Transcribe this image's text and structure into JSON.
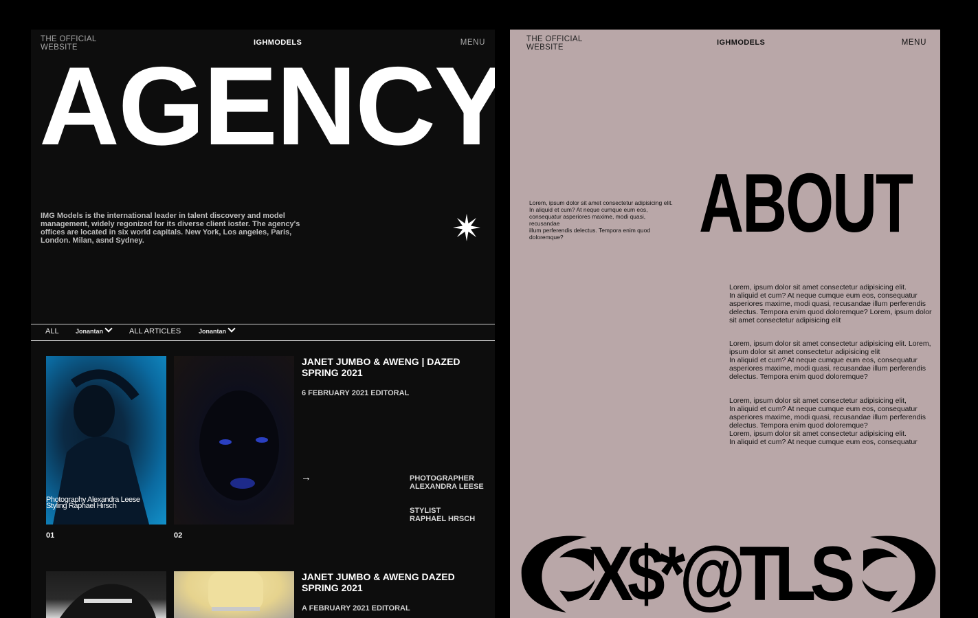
{
  "left": {
    "header": {
      "tagline": "THE OFFICIAL\nWEBSITE",
      "brand": "IGHMODELS",
      "menu": "MENU"
    },
    "hero_title": "AGENCY",
    "intro": "IMG Models is the international leader in talent discovery and model management, widely regonized for its diverse client ioster. The agency's offices are located in six world capitals. New York, Los angeles, Paris, London. Milan, asnd Sydney.",
    "filters": [
      {
        "label": "ALL"
      },
      {
        "label": "Jonantan"
      },
      {
        "label": "ALL ARTICLES"
      },
      {
        "label": "Jonantan"
      }
    ],
    "article1": {
      "title": "JANET JUMBO & AWENG | DAZED SPRING 2021",
      "date": "6 FEBRUARY 2021 EDITORAL",
      "photo1_caption_line1": "Photography Alexandra Leese",
      "photo1_caption_line2": "Styling Raphael Hirsch",
      "num1": "01",
      "num2": "02",
      "arrow": "→",
      "photographer_label": "PHOTOGRAPHER",
      "photographer_name": "ALEXANDRA LEESE",
      "stylist_label": "STYLIST",
      "stylist_name": "RAPHAEL HRSCH"
    },
    "article2": {
      "title": "JANET JUMBO & AWENG DAZED SPRING 2021",
      "date": "A FEBRUARY 2021 EDITORAL"
    }
  },
  "right": {
    "header": {
      "tagline": "THE OFFICIAL\nWEBSITE",
      "brand": "IGHMODELS",
      "menu": "MENU"
    },
    "hero_title": "ABOUT",
    "small_text": "Lorem, ipsum dolor sit amet consectetur adipisicing elit. In aliquid et cum? At neque cumque eum eos, consequatur asperiores maxime, modi quasi, recusandae\nillum perferendis delectus. Tempora enim quod doloremque?",
    "paragraphs": [
      "Lorem, ipsum dolor sit amet consectetur adipisicing elit.\nIn aliquid et cum? At neque cumque eum eos, consequatur asperiores maxime, modi quasi, recusandae illum perferendis delectus. Tempora enim quod doloremque? Lorem, ipsum dolor sit amet consectetur adipisicing elit",
      "Lorem, ipsum dolor sit amet consectetur adipisicing elit. Lorem, ipsum dolor sit amet consectetur adipisicing elit\nIn aliquid et cum? At neque cumque eum eos, consequatur asperiores maxime, modi quasi, recusandae illum perferendis delectus. Tempora enim quod doloremque?",
      "Lorem, ipsum dolor sit amet consectetur adipisicing elit,\nIn aliquid et cum? At neque cumque eum eos, consequatur asperiores maxime, modi quasi, recusandae illum perferendis delectus. Tempora enim quod doloremque?\nLorem, ipsum dolor sit amet consectetur adipisicing elit.\nIn aliquid et cum? At neque cumque eum eos, consequatur"
    ],
    "logo_text": "X$*@TLS"
  },
  "colors": {
    "left_bg": "#0d0d0d",
    "right_bg": "#b9a7a8",
    "page_bg": "#000000"
  }
}
